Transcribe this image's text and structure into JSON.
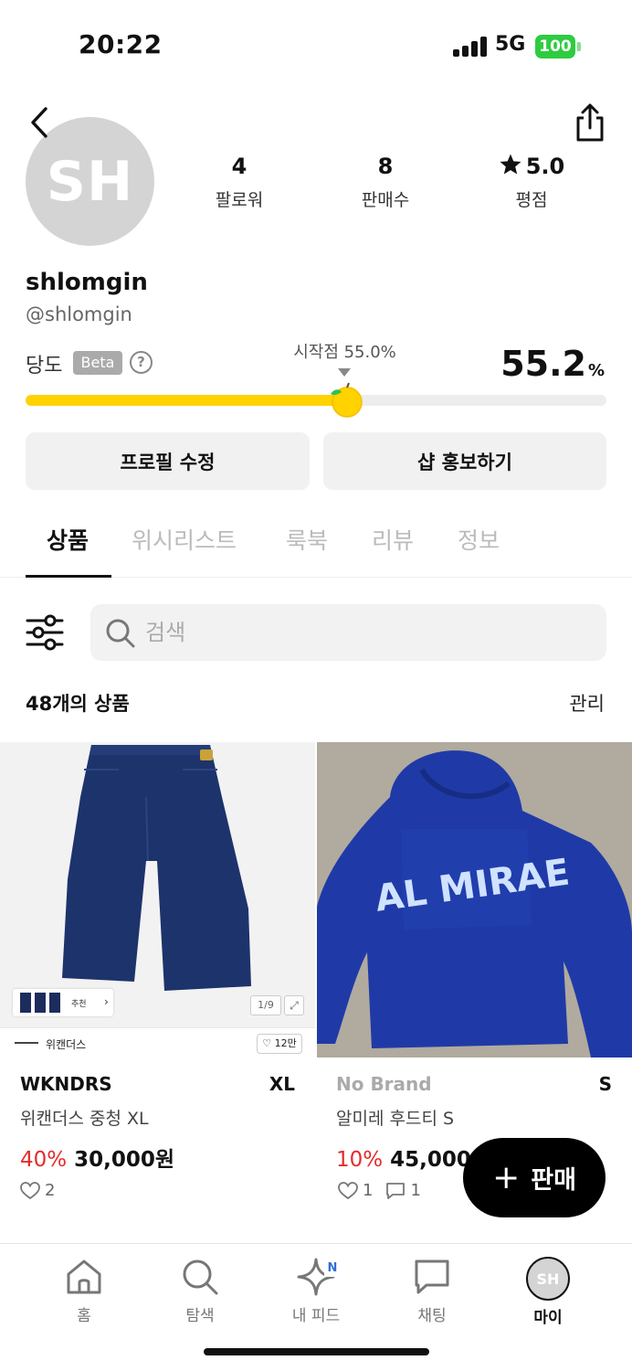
{
  "status_bar": {
    "time": "20:22",
    "network": "5G",
    "battery": "100"
  },
  "profile": {
    "initials": "SH",
    "username": "shlomgin",
    "handle": "@shlomgin",
    "stats": [
      {
        "value": "4",
        "label": "팔로워"
      },
      {
        "value": "8",
        "label": "판매수"
      },
      {
        "value": "5.0",
        "label": "평점"
      }
    ],
    "sweetness": {
      "label": "당도",
      "badge": "Beta",
      "help": "?",
      "start_label": "시작점 55.0%",
      "value": "55.2",
      "unit": "%",
      "progress_fraction": 0.552
    },
    "edit_button": "프로필 수정",
    "promote_button": "샵 홍보하기"
  },
  "tabs": [
    {
      "label": "상품",
      "active": true
    },
    {
      "label": "위시리스트",
      "active": false
    },
    {
      "label": "룩북",
      "active": false
    },
    {
      "label": "리뷰",
      "active": false
    },
    {
      "label": "정보",
      "active": false
    }
  ],
  "search": {
    "placeholder": "검색",
    "value": ""
  },
  "list_header": {
    "count_label": "48개의 상품",
    "manage_label": "관리"
  },
  "products": [
    {
      "thumb_text": "추천",
      "image_counter": "1/9",
      "shop_name": "위캔더스",
      "shop_likes": "12만",
      "brand": "WKNDRS",
      "size": "XL",
      "title": "위캔더스 중청 XL",
      "discount": "40%",
      "price": "30,000원",
      "likes": "2"
    },
    {
      "graphic_text": "AL MIRAE",
      "brand": "No Brand",
      "size": "S",
      "title": "알미레 후드티 S",
      "discount": "10%",
      "price": "45,000원",
      "likes": "1",
      "chats": "1"
    }
  ],
  "fab": {
    "plus": "+",
    "label": "판매"
  },
  "bottom_nav": [
    {
      "label": "홈",
      "icon": "home-icon"
    },
    {
      "label": "탐색",
      "icon": "search-icon"
    },
    {
      "label": "내 피드",
      "icon": "sparkle-icon",
      "badge": "N"
    },
    {
      "label": "채팅",
      "icon": "chat-icon"
    },
    {
      "label": "마이",
      "icon": "avatar"
    }
  ],
  "colors": {
    "accent_yellow": "#ffd200",
    "discount_red": "#e42b2b",
    "battery_green": "#2ecc40"
  }
}
